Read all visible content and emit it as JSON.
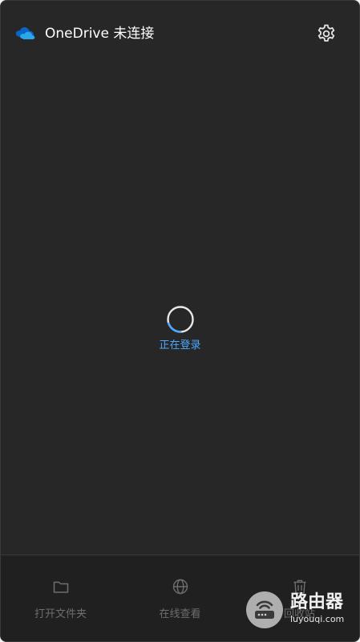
{
  "header": {
    "title": "OneDrive 未连接",
    "logo_icon": "onedrive-cloud-icon",
    "settings_icon": "gear-icon"
  },
  "status": {
    "text": "正在登录",
    "spinner_icon": "loading-spinner-icon"
  },
  "footer": {
    "buttons": [
      {
        "label": "打开文件夹",
        "icon": "folder-icon"
      },
      {
        "label": "在线查看",
        "icon": "globe-icon"
      },
      {
        "label": "回收站",
        "icon": "trash-icon"
      }
    ]
  },
  "watermark": {
    "text": "路由器",
    "url": "luyouqi.com"
  },
  "colors": {
    "background": "#272727",
    "footer": "#202020",
    "accent": "#4aa8ff",
    "title": "#ffffff",
    "muted": "#6e6e6e"
  }
}
